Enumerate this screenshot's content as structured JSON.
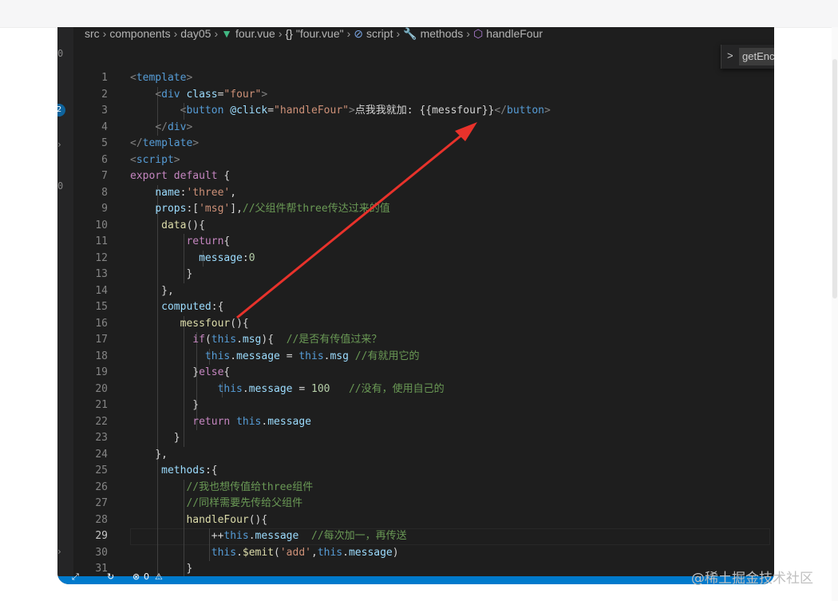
{
  "breadcrumb": {
    "items": [
      "src",
      "components",
      "day05",
      "four.vue",
      "\"four.vue\"",
      "script",
      "methods",
      "handleFour"
    ],
    "icons": {
      "file": "vue-icon",
      "braces": "braces-icon",
      "script": "script-icon",
      "methods": "wrench-icon",
      "handler": "cube-icon"
    }
  },
  "find_widget": {
    "value": "getEnc"
  },
  "activity_bar": {
    "badge": "2",
    "digits": [
      "0",
      "0",
      "0"
    ]
  },
  "code_lines": [
    {
      "n": "1",
      "html": "<span class='t-tag'>&lt;</span><span class='t-tn'>template</span><span class='t-tag'>&gt;</span>"
    },
    {
      "n": "2",
      "html": "    <span class='t-tag'>&lt;</span><span class='t-tn'>div</span> <span class='t-attr'>class</span><span class='t-op'>=</span><span class='t-str'>\"four\"</span><span class='t-tag'>&gt;</span>"
    },
    {
      "n": "3",
      "html": "        <span class='t-tag'>&lt;</span><span class='t-tn'>button</span> <span class='t-attr'>@click</span><span class='t-op'>=</span><span class='t-str'>\"handleFour\"</span><span class='t-tag'>&gt;</span><span class='t-txt'>点我我就加: {{messfour}}</span><span class='t-tag'>&lt;/</span><span class='t-tn'>button</span><span class='t-tag'>&gt;</span>"
    },
    {
      "n": "4",
      "html": "    <span class='t-tag'>&lt;/</span><span class='t-tn'>div</span><span class='t-tag'>&gt;</span>"
    },
    {
      "n": "5",
      "html": "<span class='t-tag'>&lt;/</span><span class='t-tn'>template</span><span class='t-tag'>&gt;</span>"
    },
    {
      "n": "6",
      "html": "<span class='t-tag'>&lt;</span><span class='t-tn'>script</span><span class='t-tag'>&gt;</span>"
    },
    {
      "n": "7",
      "html": "<span class='t-kw'>export</span> <span class='t-kw'>default</span> <span class='t-op'>{</span>"
    },
    {
      "n": "8",
      "html": "    <span class='t-prop'>name</span><span class='t-op'>:</span><span class='t-str'>'three'</span><span class='t-op'>,</span>"
    },
    {
      "n": "9",
      "html": "    <span class='t-prop'>props</span><span class='t-op'>:[</span><span class='t-str'>'msg'</span><span class='t-op'>],</span><span class='t-com'>//父组件帮three传达过来的值</span>"
    },
    {
      "n": "10",
      "html": "     <span class='t-fn'>data</span><span class='t-op'>(){</span>"
    },
    {
      "n": "11",
      "html": "         <span class='t-kw'>return</span><span class='t-op'>{</span>"
    },
    {
      "n": "12",
      "html": "           <span class='t-prop'>message</span><span class='t-op'>:</span><span class='t-num'>0</span>"
    },
    {
      "n": "13",
      "html": "         <span class='t-op'>}</span>"
    },
    {
      "n": "14",
      "html": "     <span class='t-op'>},</span>"
    },
    {
      "n": "15",
      "html": "     <span class='t-prop'>computed</span><span class='t-op'>:{</span>"
    },
    {
      "n": "16",
      "html": "        <span class='t-fn'>messfour</span><span class='t-op'>(){</span>"
    },
    {
      "n": "17",
      "html": "          <span class='t-kw'>if</span><span class='t-op'>(</span><span class='t-kw2'>this</span><span class='t-op'>.</span><span class='t-prop'>msg</span><span class='t-op'>){</span>  <span class='t-com'>//是否有传值过来？</span>"
    },
    {
      "n": "18",
      "html": "            <span class='t-kw2'>this</span><span class='t-op'>.</span><span class='t-prop'>message</span> <span class='t-op'>=</span> <span class='t-kw2'>this</span><span class='t-op'>.</span><span class='t-prop'>msg</span> <span class='t-com'>//有就用它的</span>"
    },
    {
      "n": "19",
      "html": "          <span class='t-op'>}</span><span class='t-kw'>else</span><span class='t-op'>{</span>"
    },
    {
      "n": "20",
      "html": "              <span class='t-kw2'>this</span><span class='t-op'>.</span><span class='t-prop'>message</span> <span class='t-op'>=</span> <span class='t-num'>100</span>   <span class='t-com'>//没有，使用自己的</span>"
    },
    {
      "n": "21",
      "html": "          <span class='t-op'>}</span>"
    },
    {
      "n": "22",
      "html": "          <span class='t-kw'>return</span> <span class='t-kw2'>this</span><span class='t-op'>.</span><span class='t-prop'>message</span>"
    },
    {
      "n": "23",
      "html": "       <span class='t-op'>}</span>"
    },
    {
      "n": "24",
      "html": "    <span class='t-op'>},</span>"
    },
    {
      "n": "25",
      "html": "     <span class='t-prop'>methods</span><span class='t-op'>:{</span>"
    },
    {
      "n": "26",
      "html": "         <span class='t-com'>//我也想传值给three组件</span>"
    },
    {
      "n": "27",
      "html": "         <span class='t-com'>//同样需要先传给父组件</span>"
    },
    {
      "n": "28",
      "html": "         <span class='t-fn'>handleFour</span><span class='t-op'>(){</span>"
    },
    {
      "n": "29",
      "html": "             <span class='t-op'>++</span><span class='t-kw2'>this</span><span class='t-op'>.</span><span class='t-prop'>message</span>  <span class='t-com'>//每次加一，再传送</span>"
    },
    {
      "n": "30",
      "html": "             <span class='t-kw2'>this</span><span class='t-op'>.</span><span class='t-fn'>$emit</span><span class='t-op'>(</span><span class='t-str'>'add'</span><span class='t-op'>,</span><span class='t-kw2'>this</span><span class='t-op'>.</span><span class='t-prop'>message</span><span class='t-op'>)</span>"
    },
    {
      "n": "31",
      "html": "         <span class='t-op'>}</span>"
    }
  ],
  "annotation": {
    "color": "#e8322b"
  },
  "watermark": "@稀土掘金技术社区",
  "colors": {
    "editor_bg": "#1e1e1e",
    "statusbar": "#007acc",
    "arrow": "#e8322b"
  }
}
